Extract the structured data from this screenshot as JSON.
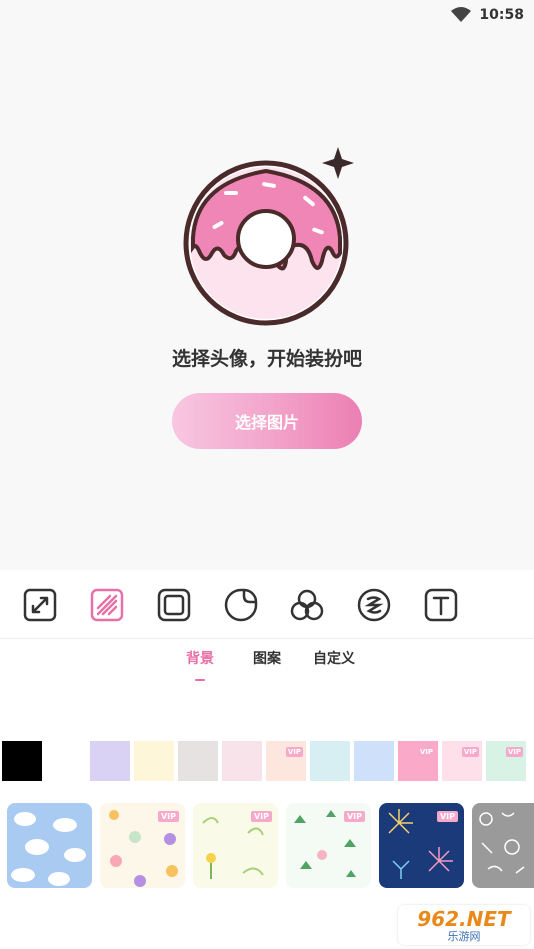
{
  "status": {
    "time": "10:58",
    "wifi_icon": "wifi-icon"
  },
  "main": {
    "headline": "选择头像，开始装扮吧",
    "pick_button": "选择图片"
  },
  "toolbar": {
    "tools": [
      "expand-icon",
      "background-pattern-icon",
      "frame-icon",
      "sticker-icon",
      "filter-icon",
      "effect-icon",
      "text-icon"
    ],
    "active_tool": "background-pattern-icon"
  },
  "tabs": {
    "items": [
      "背景",
      "图案",
      "自定义"
    ],
    "active": "背景"
  },
  "colors": {
    "accent": "#e870a8",
    "swatches": [
      {
        "color": "#000000",
        "vip": false
      },
      {
        "color": "#ffffff",
        "vip": false
      },
      {
        "color": "#d9d2f5",
        "vip": false
      },
      {
        "color": "#fdf6d8",
        "vip": false
      },
      {
        "color": "#e6e2e2",
        "vip": false
      },
      {
        "color": "#f8e3ea",
        "vip": false
      },
      {
        "color": "#fde6dd",
        "vip": true
      },
      {
        "color": "#d7eef3",
        "vip": false
      },
      {
        "color": "#cfe0fa",
        "vip": false
      },
      {
        "color": "#fba9c8",
        "vip": true
      },
      {
        "color": "#fde0e9",
        "vip": true
      },
      {
        "color": "#d9f2e6",
        "vip": true
      }
    ],
    "vip_label": "VIP"
  },
  "patterns": [
    {
      "name": "sheep-pattern",
      "vip": false
    },
    {
      "name": "flower-pattern",
      "vip": true
    },
    {
      "name": "yellow-flower-pattern",
      "vip": true
    },
    {
      "name": "leaf-pattern",
      "vip": true
    },
    {
      "name": "firework-pattern",
      "vip": true
    },
    {
      "name": "doodle-pattern",
      "vip": false
    }
  ],
  "watermark": {
    "top": "962.NET",
    "bottom": "乐游网"
  }
}
